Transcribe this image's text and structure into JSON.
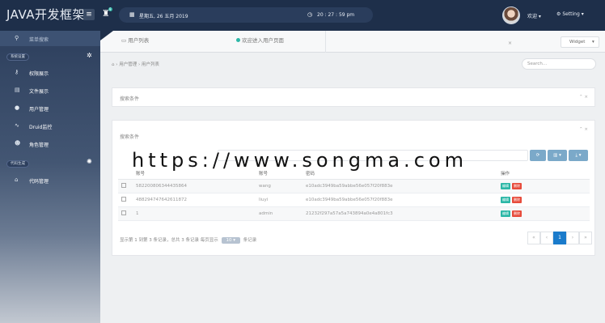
{
  "app": {
    "logo": "JAVA开发框架"
  },
  "topbar": {
    "date": "星期五, 26 五月 2019",
    "time": "20 : 27 : 59 pm",
    "welcome": "欢迎 ▾",
    "settings": "Setting ▾",
    "bell_badge": "8"
  },
  "sidebar": {
    "header_label": "菜单搜索",
    "group1_tag": "系统设置",
    "items": [
      {
        "label": "权限展示",
        "icon": "key-icon"
      },
      {
        "label": "文件展示",
        "icon": "file-icon"
      },
      {
        "label": "用户管理",
        "icon": "user-icon"
      },
      {
        "label": "Druid监控",
        "icon": "chart-icon"
      },
      {
        "label": "角色管理",
        "icon": "users-icon"
      }
    ],
    "group2_tag": "代码生成",
    "items2": [
      {
        "label": "代码管理",
        "icon": "home-icon"
      }
    ]
  },
  "tabs": {
    "active": "用户列表",
    "second": "欢迎进入用户页面",
    "widget": "Widget"
  },
  "breadcrumb": {
    "text": "› 用户管理 › 用户列表"
  },
  "search_top": {
    "placeholder": "Search..."
  },
  "panel1": {
    "title": "搜索条件"
  },
  "panel2": {
    "title": "搜索条件"
  },
  "table": {
    "headers": [
      "",
      "账号",
      "账号",
      "密码",
      "操作"
    ],
    "rows": [
      {
        "id": "582200806344435864",
        "account": "wang",
        "password": "e10adc3949ba59abbe56e057f20f883e"
      },
      {
        "id": "488294747642611872",
        "account": "liuyi",
        "password": "e10adc3949ba59abbe56e057f20f883e"
      },
      {
        "id": "1",
        "account": "admin",
        "password": "21232f297a57a5a743894a0e4a801fc3"
      }
    ],
    "edit_label": "编辑",
    "delete_label": "删除"
  },
  "pagination": {
    "info_prefix": "显示第 1 到第 3 条记录，总共 3 条记录 每页显示",
    "page_size": "10 ▾",
    "info_suffix": "条记录",
    "current_page": "1"
  },
  "watermark": "https://www.songma.com",
  "colors": {
    "topbar": "#1e2f4a",
    "accent": "#2cb7a7",
    "danger": "#e74c3c",
    "primary": "#1a7bcb"
  }
}
